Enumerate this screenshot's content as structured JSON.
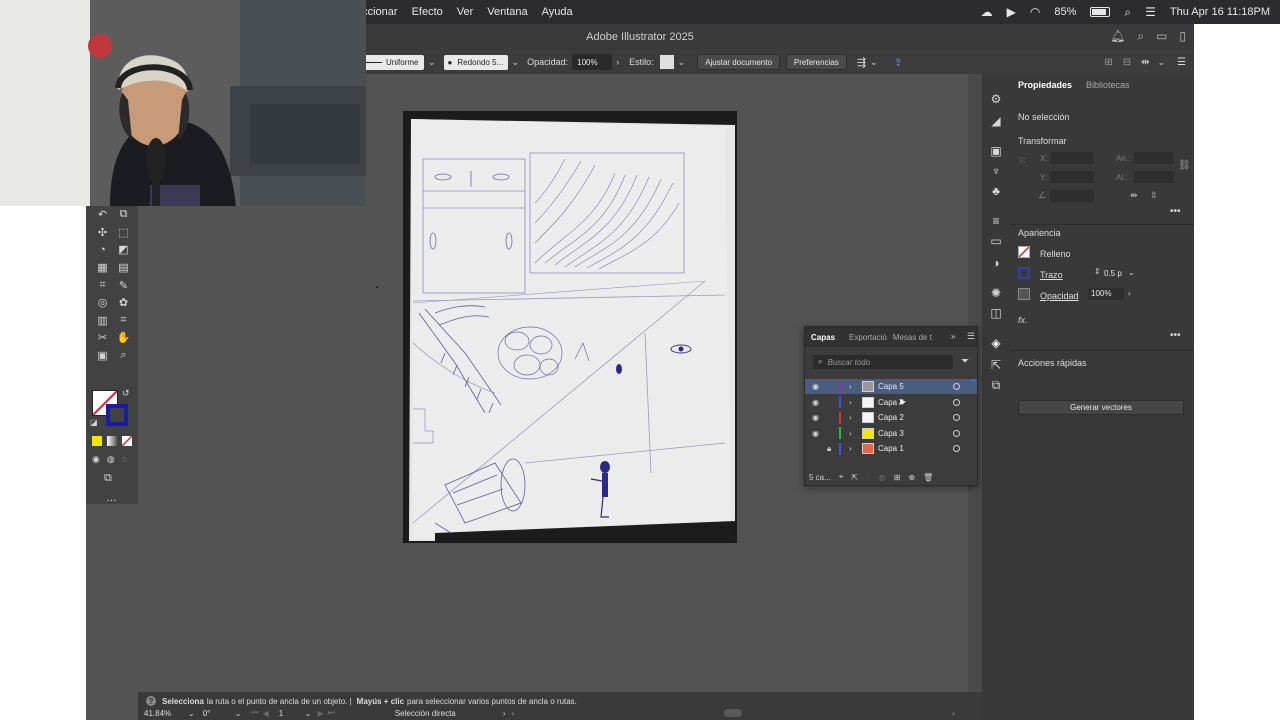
{
  "menubar": {
    "items": [
      "eccionar",
      "Efecto",
      "Ver",
      "Ventana",
      "Ayuda"
    ],
    "battery_percent": "85%",
    "datetime": "Thu Apr 16  11:18PM"
  },
  "app": {
    "title": "Adobe Illustrator 2025"
  },
  "control_bar": {
    "stroke_profile": "Uniforme",
    "brush": "Redondo 5...",
    "opacity_label": "Opacidad:",
    "opacity_value": "100%",
    "style_label": "Estilo:",
    "fit_document_button": "Ajustar documento",
    "preferences_button": "Preferencias"
  },
  "properties": {
    "tabs": [
      "Propiedades",
      "Bibliotecas"
    ],
    "no_selection": "No selección",
    "transform_title": "Transformar",
    "x_label": "X:",
    "y_label": "Y:",
    "w_label": "An.:",
    "h_label": "Al.:",
    "appearance_title": "Apariencia",
    "fill_label": "Relleno",
    "stroke_label": "Trazo",
    "stroke_value": "0.5 p",
    "opacity_label": "Opacidad",
    "opacity_value": "100%",
    "fx_label": "fx.",
    "quick_actions_title": "Acciones rápidas",
    "generate_vectors_button": "Generar vectores"
  },
  "layers_panel": {
    "tabs": [
      "Capas",
      "Exportació",
      "Mesas de t"
    ],
    "search_placeholder": "Buscar todo",
    "layers": [
      {
        "name": "Capa 5",
        "color": "#7b3fa0",
        "visible": true,
        "locked": false,
        "selected": true,
        "thumb": "#9a9a9a"
      },
      {
        "name": "Capa 4",
        "color": "#3a55d6",
        "visible": true,
        "locked": false,
        "selected": false,
        "thumb": "#f4f4f4"
      },
      {
        "name": "Capa 2",
        "color": "#d13b3b",
        "visible": true,
        "locked": false,
        "selected": false,
        "thumb": "#f4f4f4"
      },
      {
        "name": "Capa 3",
        "color": "#35b53a",
        "visible": true,
        "locked": false,
        "selected": false,
        "thumb": "#f3e600"
      },
      {
        "name": "Capa 1",
        "color": "#3a55d6",
        "visible": false,
        "locked": true,
        "selected": false,
        "thumb": "#e1674a"
      }
    ],
    "footer_count": "5 ca..."
  },
  "status_bar": {
    "hint_bold_1": "Selecciona",
    "hint_text_1": "la ruta o el punto de ancla de un objeto.  |",
    "hint_bold_2": "Mayús + clic",
    "hint_text_2": "para seleccionar varios puntos de ancla o rutas.",
    "zoom": "41.84%",
    "rotation": "0°",
    "artboard_number": "1",
    "tool_name": "Selección directa"
  },
  "colors": {
    "app_bg": "#535353",
    "panel_bg": "#393939",
    "selection_blue": "#4a5d80",
    "accent_blue": "#2f6fd6"
  }
}
